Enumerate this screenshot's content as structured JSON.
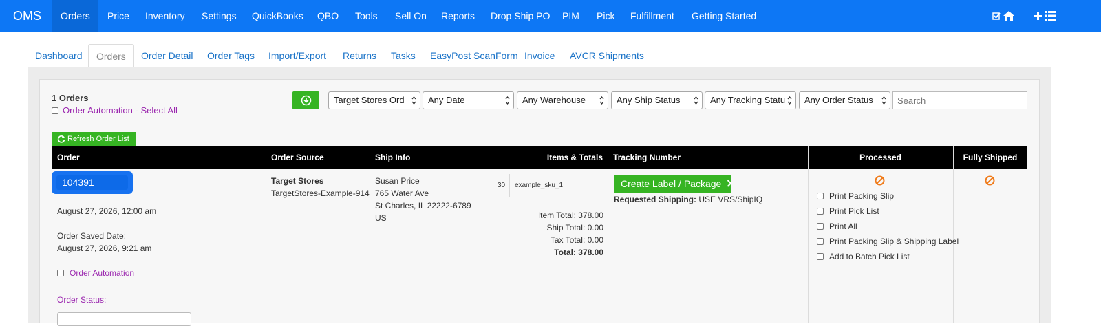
{
  "navbar": {
    "brand": "OMS",
    "items": [
      "Orders",
      "Price",
      "Inventory",
      "Settings",
      "QuickBooks",
      "QBO",
      "Tools",
      "Sell On",
      "Reports",
      "Drop Ship PO",
      "PIM",
      "Pick",
      "Fulfillment",
      "Getting Started"
    ],
    "active_item": "Orders",
    "right_icons": [
      "check-square-icon",
      "home-icon",
      "plus-icon",
      "list-icon"
    ],
    "color": "#0d77f5"
  },
  "tabs": {
    "items": [
      "Dashboard",
      "Orders",
      "Order Detail",
      "Order Tags",
      "Import/Export",
      "Returns",
      "Tasks",
      "EasyPost ScanForm",
      "Invoice",
      "AVCR Shipments"
    ],
    "active": "Orders"
  },
  "toolbar": {
    "order_count": "1 Orders",
    "automation_select_all": "Order Automation - Select All",
    "download_icon": "download-circle-icon",
    "filters": [
      "Target Stores Ord",
      "Any Date",
      "Any Warehouse",
      "Any Ship Status",
      "Any Tracking Statu",
      "Any Order Status"
    ],
    "search_placeholder": "Search",
    "refresh_label": "Refresh Order List"
  },
  "table": {
    "headers": [
      "Order",
      "Order Source",
      "Ship Info",
      "Items & Totals",
      "Tracking Number",
      "Processed",
      "Fully Shipped"
    ],
    "row": {
      "order_number": "104391",
      "order_date": "August 27, 2026, 12:00 am",
      "saved_label": "Order Saved Date:",
      "saved_date": "August 27, 2026, 9:21 am",
      "automation_label": "Order Automation",
      "status_label": "Order Status:",
      "source_name": "Target Stores",
      "source_id": "TargetStores-Example-914",
      "ship_name": "Susan Price",
      "ship_street": "765 Water Ave",
      "ship_city": "St Charles, IL 22222-6789",
      "ship_country": "US",
      "item_qty": "30",
      "item_sku": "example_sku_1",
      "item_total": "Item Total: 378.00",
      "ship_total": "Ship Total: 0.00",
      "tax_total": "Tax Total: 0.00",
      "grand_total": "Total: 378.00",
      "create_label": "Create Label / Package",
      "requested_shipping_label": "Requested Shipping:",
      "requested_shipping_value": "USE VRS/ShipIQ",
      "processed_options": [
        "Print Packing Slip",
        "Print Pick List",
        "Print All",
        "Print Packing Slip & Shipping Label",
        "Add to Batch Pick List"
      ],
      "status_icon_color": "#f07b1a"
    }
  },
  "colors": {
    "green": "#36b423",
    "link_blue": "#1a73c8",
    "purple": "#9b27af"
  }
}
